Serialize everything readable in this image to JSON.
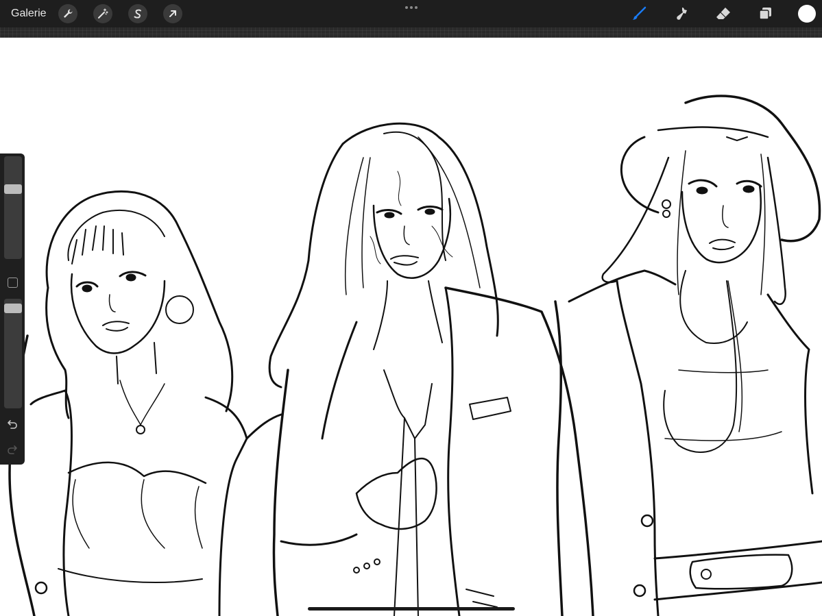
{
  "toolbar": {
    "gallery_label": "Galerie",
    "left_tools": [
      {
        "icon": "wrench-icon",
        "name": "actions"
      },
      {
        "icon": "magic-wand-icon",
        "name": "adjustments"
      },
      {
        "icon": "selection-s-icon",
        "name": "selection"
      },
      {
        "icon": "arrow-cursor-icon",
        "name": "transform"
      }
    ],
    "right_tools": [
      {
        "icon": "brush-icon",
        "name": "paint",
        "active": true
      },
      {
        "icon": "smudge-icon",
        "name": "smudge",
        "active": false
      },
      {
        "icon": "eraser-icon",
        "name": "erase",
        "active": false
      },
      {
        "icon": "layers-icon",
        "name": "layers",
        "active": false
      }
    ],
    "active_color": "#ffffff",
    "accent_color": "#1a7cf5"
  },
  "sidebar": {
    "brush_size_level": 0.7,
    "opacity_level": 0.95,
    "tools": [
      "modify-icon",
      "undo-icon",
      "redo-icon"
    ]
  },
  "canvas": {
    "content": "line-art-three-figures-sketch"
  }
}
